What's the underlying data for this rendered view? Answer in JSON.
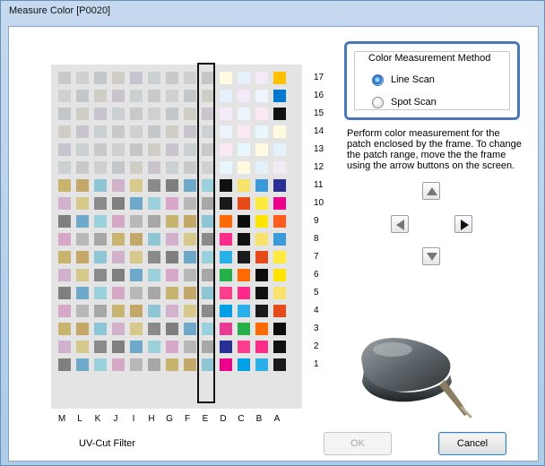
{
  "window": {
    "title": "Measure Color [P0020]"
  },
  "measurement_method": {
    "group_label": "Color Measurement Method",
    "options": [
      {
        "label": "Line Scan",
        "selected": true
      },
      {
        "label": "Spot Scan",
        "selected": false
      }
    ]
  },
  "instructions": "Perform color measurement for the patch enclosed by the frame. To change the patch range, move the the frame using the arrow buttons on the screen.",
  "patch_grid": {
    "columns": [
      "M",
      "L",
      "K",
      "J",
      "I",
      "H",
      "G",
      "F",
      "E",
      "D",
      "C",
      "B",
      "A"
    ],
    "rows": [
      "17",
      "16",
      "15",
      "14",
      "13",
      "12",
      "11",
      "10",
      "9",
      "8",
      "7",
      "6",
      "5",
      "4",
      "3",
      "2",
      "1"
    ],
    "selected_column": "E"
  },
  "arrow_buttons": {
    "up": "arrow-up-icon",
    "down": "arrow-down-icon",
    "left": "arrow-left-icon",
    "right": "arrow-right-icon"
  },
  "footer": {
    "uv_filter_label": "UV-Cut Filter",
    "ok_label": "OK",
    "cancel_label": "Cancel"
  },
  "colors": {
    "accent": "#4b79b8",
    "frame": "#111111"
  }
}
